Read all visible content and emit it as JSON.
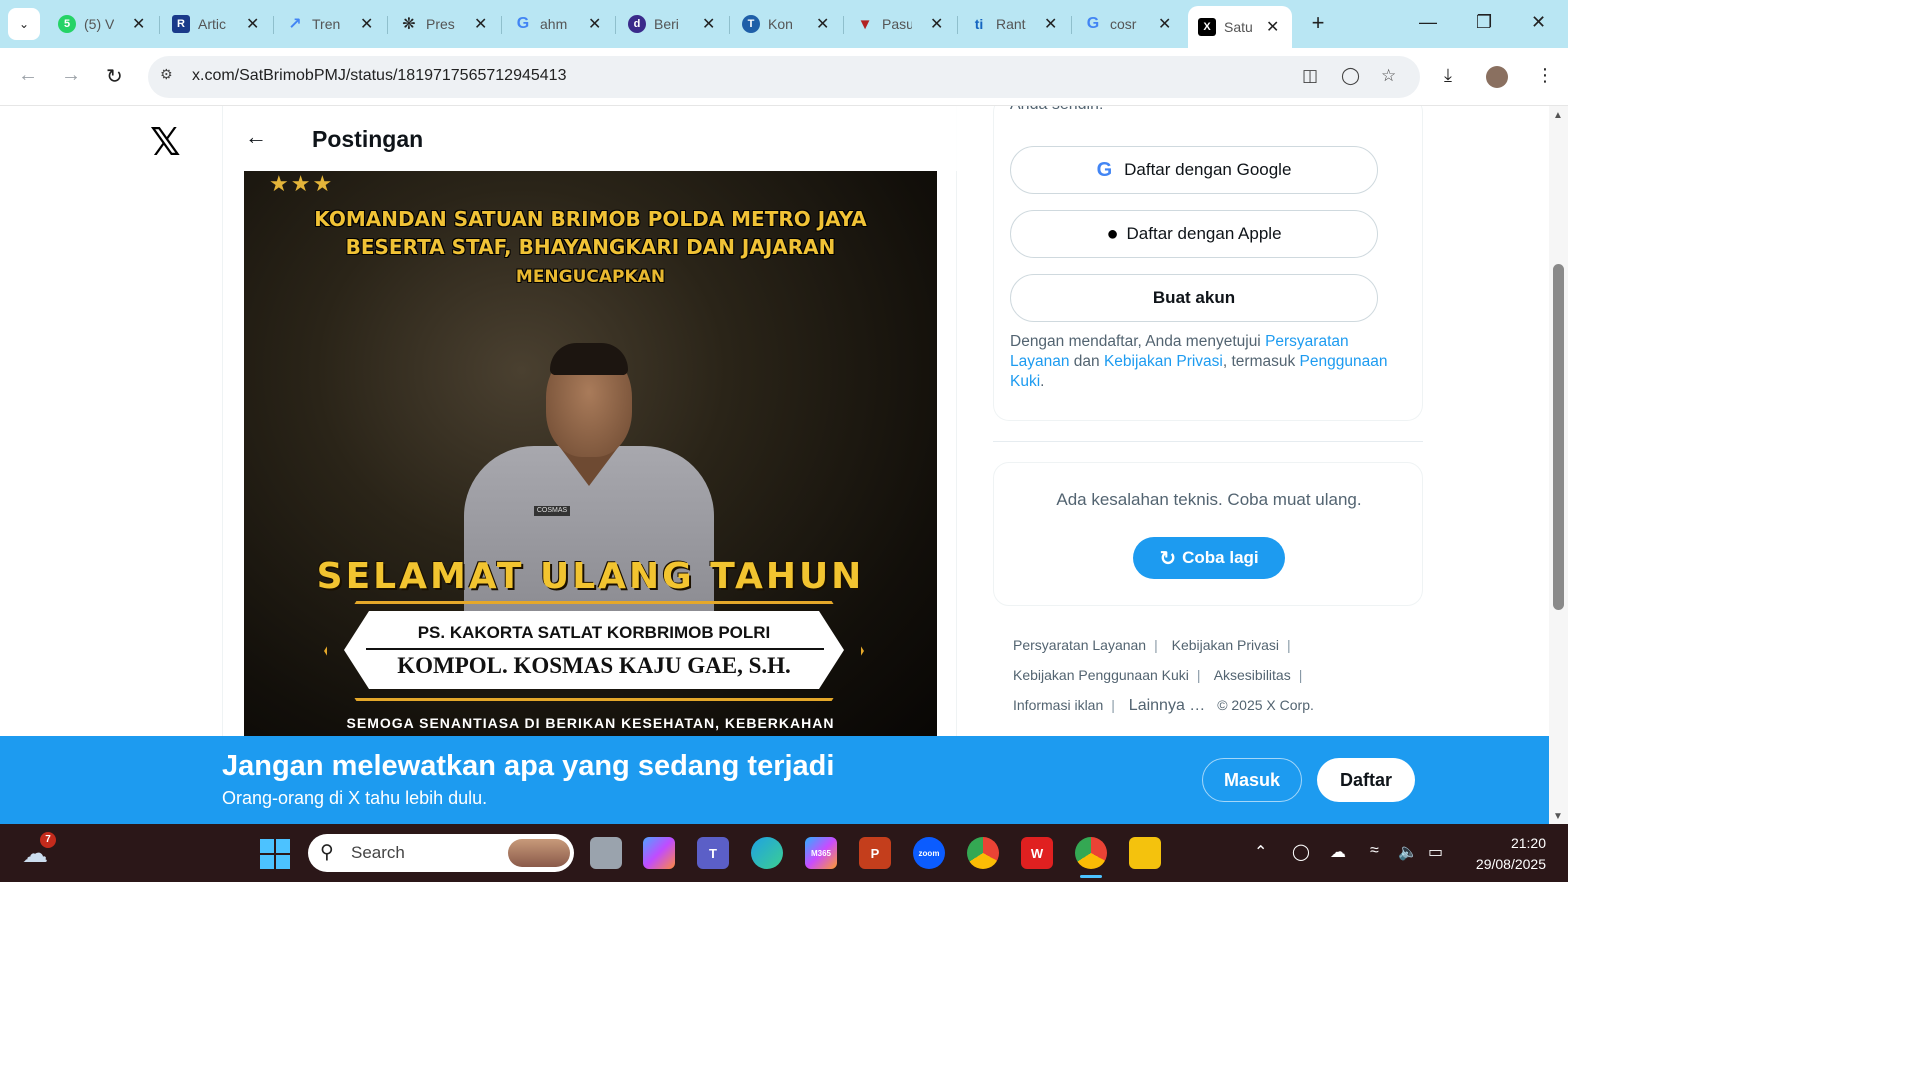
{
  "browser": {
    "tabs": [
      {
        "title": "(5) V",
        "favicon": "whatsapp-icon",
        "color": "#25d366",
        "glyph": "5"
      },
      {
        "title": "Artic",
        "favicon": "ro-icon",
        "color": "#1a3a8a",
        "glyph": "R"
      },
      {
        "title": "Tren",
        "favicon": "trends-icon",
        "color": "#4285f4",
        "glyph": "~"
      },
      {
        "title": "Pres",
        "favicon": "openai-icon",
        "color": "#222222",
        "glyph": "@"
      },
      {
        "title": "ahm",
        "favicon": "google-icon",
        "color": "#4285f4",
        "glyph": "G"
      },
      {
        "title": "Beri",
        "favicon": "detik-icon",
        "color": "#3a2a8a",
        "glyph": "d"
      },
      {
        "title": "Kon",
        "favicon": "kompas-icon",
        "color": "#1f5fa8",
        "glyph": "T"
      },
      {
        "title": "Pasu",
        "favicon": "pasundan-icon",
        "color": "#b22222",
        "glyph": "Y"
      },
      {
        "title": "Rant",
        "favicon": "ti-icon",
        "color": "#1565c0",
        "glyph": "ti"
      },
      {
        "title": "cosr",
        "favicon": "google-icon",
        "color": "#4285f4",
        "glyph": "G"
      },
      {
        "title": "Satu",
        "favicon": "x-icon",
        "color": "#000000",
        "glyph": "X",
        "active": true
      }
    ],
    "url": "x.com/SatBrimobPMJ/status/1819717565712945413"
  },
  "x": {
    "header_title": "Postingan",
    "banner": {
      "line1": "KOMANDAN SATUAN BRIMOB POLDA METRO JAYA",
      "line2": "BESERTA STAF, BHAYANGKARI DAN JAJARAN",
      "line3": "MENGUCAPKAN",
      "greeting": "SELAMAT ULANG TAHUN",
      "position": "PS. KAKORTA SATLAT KORBRIMOB POLRI",
      "name": "KOMPOL. KOSMAS KAJU GAE, S.H.",
      "wish": "SEMOGA SENANTIASA DI BERIKAN KESEHATAN, KEBERKAHAN",
      "nametag": "COSMAS"
    },
    "signup": {
      "intro": "Anda sendiri!",
      "google": "Daftar dengan Google",
      "apple": "Daftar dengan Apple",
      "create": "Buat akun",
      "terms_pre": "Dengan mendaftar, Anda menyetujui ",
      "terms_link1": "Persyaratan Layanan",
      "terms_mid1": " dan ",
      "terms_link2": "Kebijakan Privasi",
      "terms_mid2": ", termasuk ",
      "terms_link3": "Penggunaan Kuki",
      "terms_end": "."
    },
    "error": {
      "message": "Ada kesalahan teknis. Coba muat ulang.",
      "retry": "Coba lagi"
    },
    "footer": {
      "links": [
        "Persyaratan Layanan",
        "Kebijakan Privasi",
        "Kebijakan Penggunaan Kuki",
        "Aksesibilitas",
        "Informasi iklan"
      ],
      "more": "Lainnya …",
      "copyright": "© 2025 X Corp."
    },
    "bottom_bar": {
      "headline": "Jangan melewatkan apa yang sedang terjadi",
      "subline": "Orang-orang di X tahu lebih dulu.",
      "login": "Masuk",
      "signup": "Daftar"
    }
  },
  "taskbar": {
    "weather_badge": "7",
    "search_placeholder": "Search",
    "time": "21:20",
    "date": "29/08/2025",
    "accent": "#1d9bf0"
  }
}
